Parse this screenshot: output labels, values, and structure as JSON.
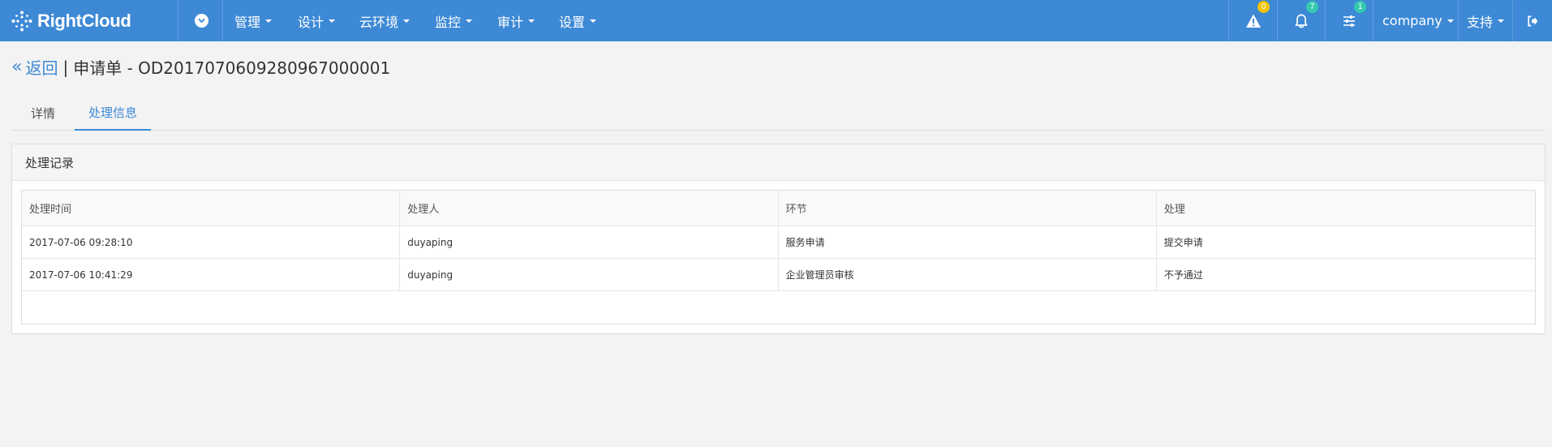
{
  "navbar": {
    "brand": "RightCloud",
    "menu": [
      {
        "label": "管理"
      },
      {
        "label": "设计"
      },
      {
        "label": "云环境"
      },
      {
        "label": "监控"
      },
      {
        "label": "审计"
      },
      {
        "label": "设置"
      }
    ],
    "alerts_count": "0",
    "notifications_count": "7",
    "settings_count": "1",
    "company": "company",
    "support": "支持",
    "colors": {
      "bar": "#3d89d6",
      "badge_alert": "#f5c400",
      "badge_info": "#36c9b0"
    }
  },
  "header": {
    "back_icon": "«",
    "back_label": "返回",
    "separator": "|",
    "title": "申请单 - OD2017070609280967000001"
  },
  "tabs": [
    {
      "label": "详情",
      "active": false
    },
    {
      "label": "处理信息",
      "active": true
    }
  ],
  "panel": {
    "title": "处理记录",
    "columns": [
      "处理时间",
      "处理人",
      "环节",
      "处理"
    ],
    "rows": [
      [
        "2017-07-06 09:28:10",
        "duyaping",
        "服务申请",
        "提交申请"
      ],
      [
        "2017-07-06 10:41:29",
        "duyaping",
        "企业管理员审核",
        "不予通过"
      ]
    ]
  }
}
